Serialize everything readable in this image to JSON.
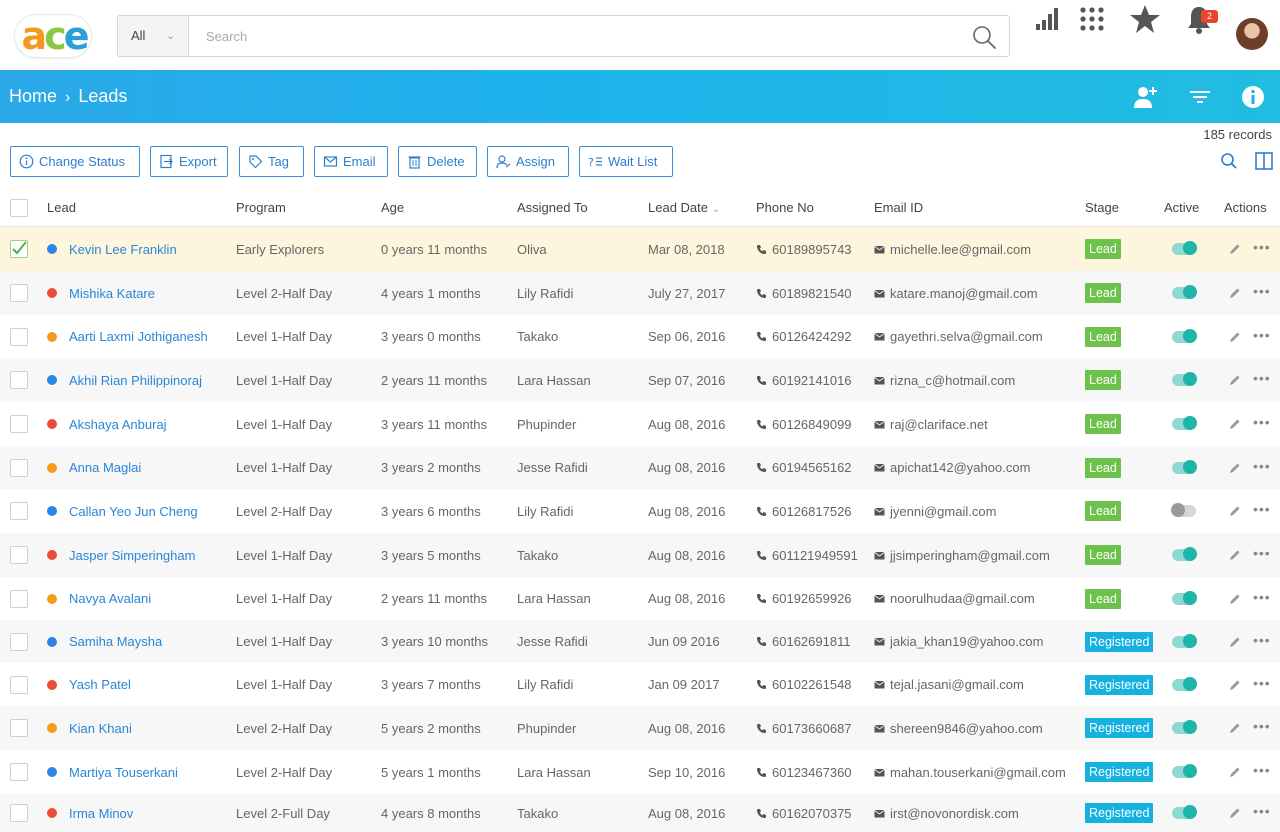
{
  "app": {
    "logo_text": "ace",
    "search": {
      "scope": "All",
      "placeholder": "Search"
    },
    "notification_count": "2"
  },
  "header": {
    "breadcrumb": [
      "Home",
      "Leads"
    ]
  },
  "records_label": "185 records",
  "toolbar": [
    {
      "label": "Change Status",
      "icon": "info-icon"
    },
    {
      "label": "Export",
      "icon": "export-icon"
    },
    {
      "label": "Tag",
      "icon": "tag-icon"
    },
    {
      "label": "Email",
      "icon": "mail-icon"
    },
    {
      "label": "Delete",
      "icon": "trash-icon"
    },
    {
      "label": "Assign",
      "icon": "assign-user-icon"
    },
    {
      "label": "Wait List",
      "icon": "wait-list-icon"
    }
  ],
  "columns": [
    "Lead",
    "Program",
    "Age",
    "Assigned To",
    "Lead Date",
    "Phone No",
    "Email ID",
    "Stage",
    "Active",
    "Actions"
  ],
  "colors": {
    "blue_dot": "#2a86e8",
    "red_dot": "#ec4c36",
    "orange_dot": "#f59c1a",
    "lead_stage": "#6cc24a",
    "registered_stage": "#15b2e0",
    "link": "#2a86d6"
  },
  "rows": [
    {
      "name": "Kevin Lee Franklin",
      "dot": "blue",
      "program": "Early Explorers",
      "age": "0 years 11 months",
      "assigned": "Oliva",
      "date": "Mar 08, 2018",
      "phone": "60189895743",
      "email": "michelle.lee@gmail.com",
      "stage": "Lead",
      "active": true,
      "selected": true
    },
    {
      "name": "Mishika Katare",
      "dot": "red",
      "program": "Level 2-Half Day",
      "age": "4 years 1 months",
      "assigned": "Lily Rafidi",
      "date": "July 27, 2017",
      "phone": "60189821540",
      "email": "katare.manoj@gmail.com",
      "stage": "Lead",
      "active": true,
      "selected": false
    },
    {
      "name": "Aarti Laxmi Jothiganesh",
      "dot": "orange",
      "program": "Level 1-Half Day",
      "age": "3 years 0 months",
      "assigned": "Takako",
      "date": "Sep 06, 2016",
      "phone": "60126424292",
      "email": "gayethri.selva@gmail.com",
      "stage": "Lead",
      "active": true,
      "selected": false
    },
    {
      "name": "Akhil Rian Philippinoraj",
      "dot": "blue",
      "program": "Level 1-Half Day",
      "age": "2 years 11 months",
      "assigned": "Lara Hassan",
      "date": "Sep 07, 2016",
      "phone": "60192141016",
      "email": "rizna_c@hotmail.com",
      "stage": "Lead",
      "active": true,
      "selected": false
    },
    {
      "name": "Akshaya Anburaj",
      "dot": "red",
      "program": "Level 1-Half Day",
      "age": "3 years 11 months",
      "assigned": "Phupinder",
      "date": "Aug 08, 2016",
      "phone": "60126849099",
      "email": "raj@clariface.net",
      "stage": "Lead",
      "active": true,
      "selected": false
    },
    {
      "name": "Anna Maglai",
      "dot": "orange",
      "program": "Level 1-Half Day",
      "age": "3 years 2 months",
      "assigned": "Jesse Rafidi",
      "date": "Aug 08, 2016",
      "phone": "60194565162",
      "email": "apichat142@yahoo.com",
      "stage": "Lead",
      "active": true,
      "selected": false
    },
    {
      "name": "Callan Yeo Jun Cheng",
      "dot": "blue",
      "program": "Level 2-Half Day",
      "age": "3 years 6 months",
      "assigned": "Lily Rafidi",
      "date": "Aug 08, 2016",
      "phone": "60126817526",
      "email": "jyenni@gmail.com",
      "stage": "Lead",
      "active": false,
      "selected": false
    },
    {
      "name": "Jasper Simperingham",
      "dot": "red",
      "program": "Level 1-Half Day",
      "age": "3 years 5 months",
      "assigned": "Takako",
      "date": "Aug 08, 2016",
      "phone": "601121949591",
      "email": "jjsimperingham@gmail.com",
      "stage": "Lead",
      "active": true,
      "selected": false
    },
    {
      "name": "Navya Avalani",
      "dot": "orange",
      "program": "Level 1-Half Day",
      "age": "2 years 11 months",
      "assigned": "Lara Hassan",
      "date": "Aug 08, 2016",
      "phone": "60192659926",
      "email": "noorulhudaa@gmail.com",
      "stage": "Lead",
      "active": true,
      "selected": false
    },
    {
      "name": "Samiha Maysha",
      "dot": "blue",
      "program": "Level 1-Half Day",
      "age": "3 years 10 months",
      "assigned": "Jesse Rafidi",
      "date": "Jun 09 2016",
      "phone": "60162691811",
      "email": "jakia_khan19@yahoo.com",
      "stage": "Registered",
      "active": true,
      "selected": false
    },
    {
      "name": "Yash Patel",
      "dot": "red",
      "program": "Level 1-Half Day",
      "age": "3 years 7 months",
      "assigned": "Lily Rafidi",
      "date": "Jan 09 2017",
      "phone": "60102261548",
      "email": "tejal.jasani@gmail.com",
      "stage": "Registered",
      "active": true,
      "selected": false
    },
    {
      "name": "Kian Khani",
      "dot": "orange",
      "program": "Level 2-Half Day",
      "age": "5 years 2 months",
      "assigned": "Phupinder",
      "date": "Aug 08, 2016",
      "phone": "60173660687",
      "email": "shereen9846@yahoo.com",
      "stage": "Registered",
      "active": true,
      "selected": false
    },
    {
      "name": "Martiya Touserkani",
      "dot": "blue",
      "program": "Level 2-Half Day",
      "age": "5 years 1 months",
      "assigned": "Lara Hassan",
      "date": "Sep 10, 2016",
      "phone": "60123467360",
      "email": "mahan.touserkani@gmail.com",
      "stage": "Registered",
      "active": true,
      "selected": false
    },
    {
      "name": "Irma Minov",
      "dot": "red",
      "program": "Level 2-Full Day",
      "age": "4 years 8 months",
      "assigned": "Takako",
      "date": "Aug 08, 2016",
      "phone": "60162070375",
      "email": "irst@novonordisk.com",
      "stage": "Registered",
      "active": true,
      "selected": false
    }
  ]
}
